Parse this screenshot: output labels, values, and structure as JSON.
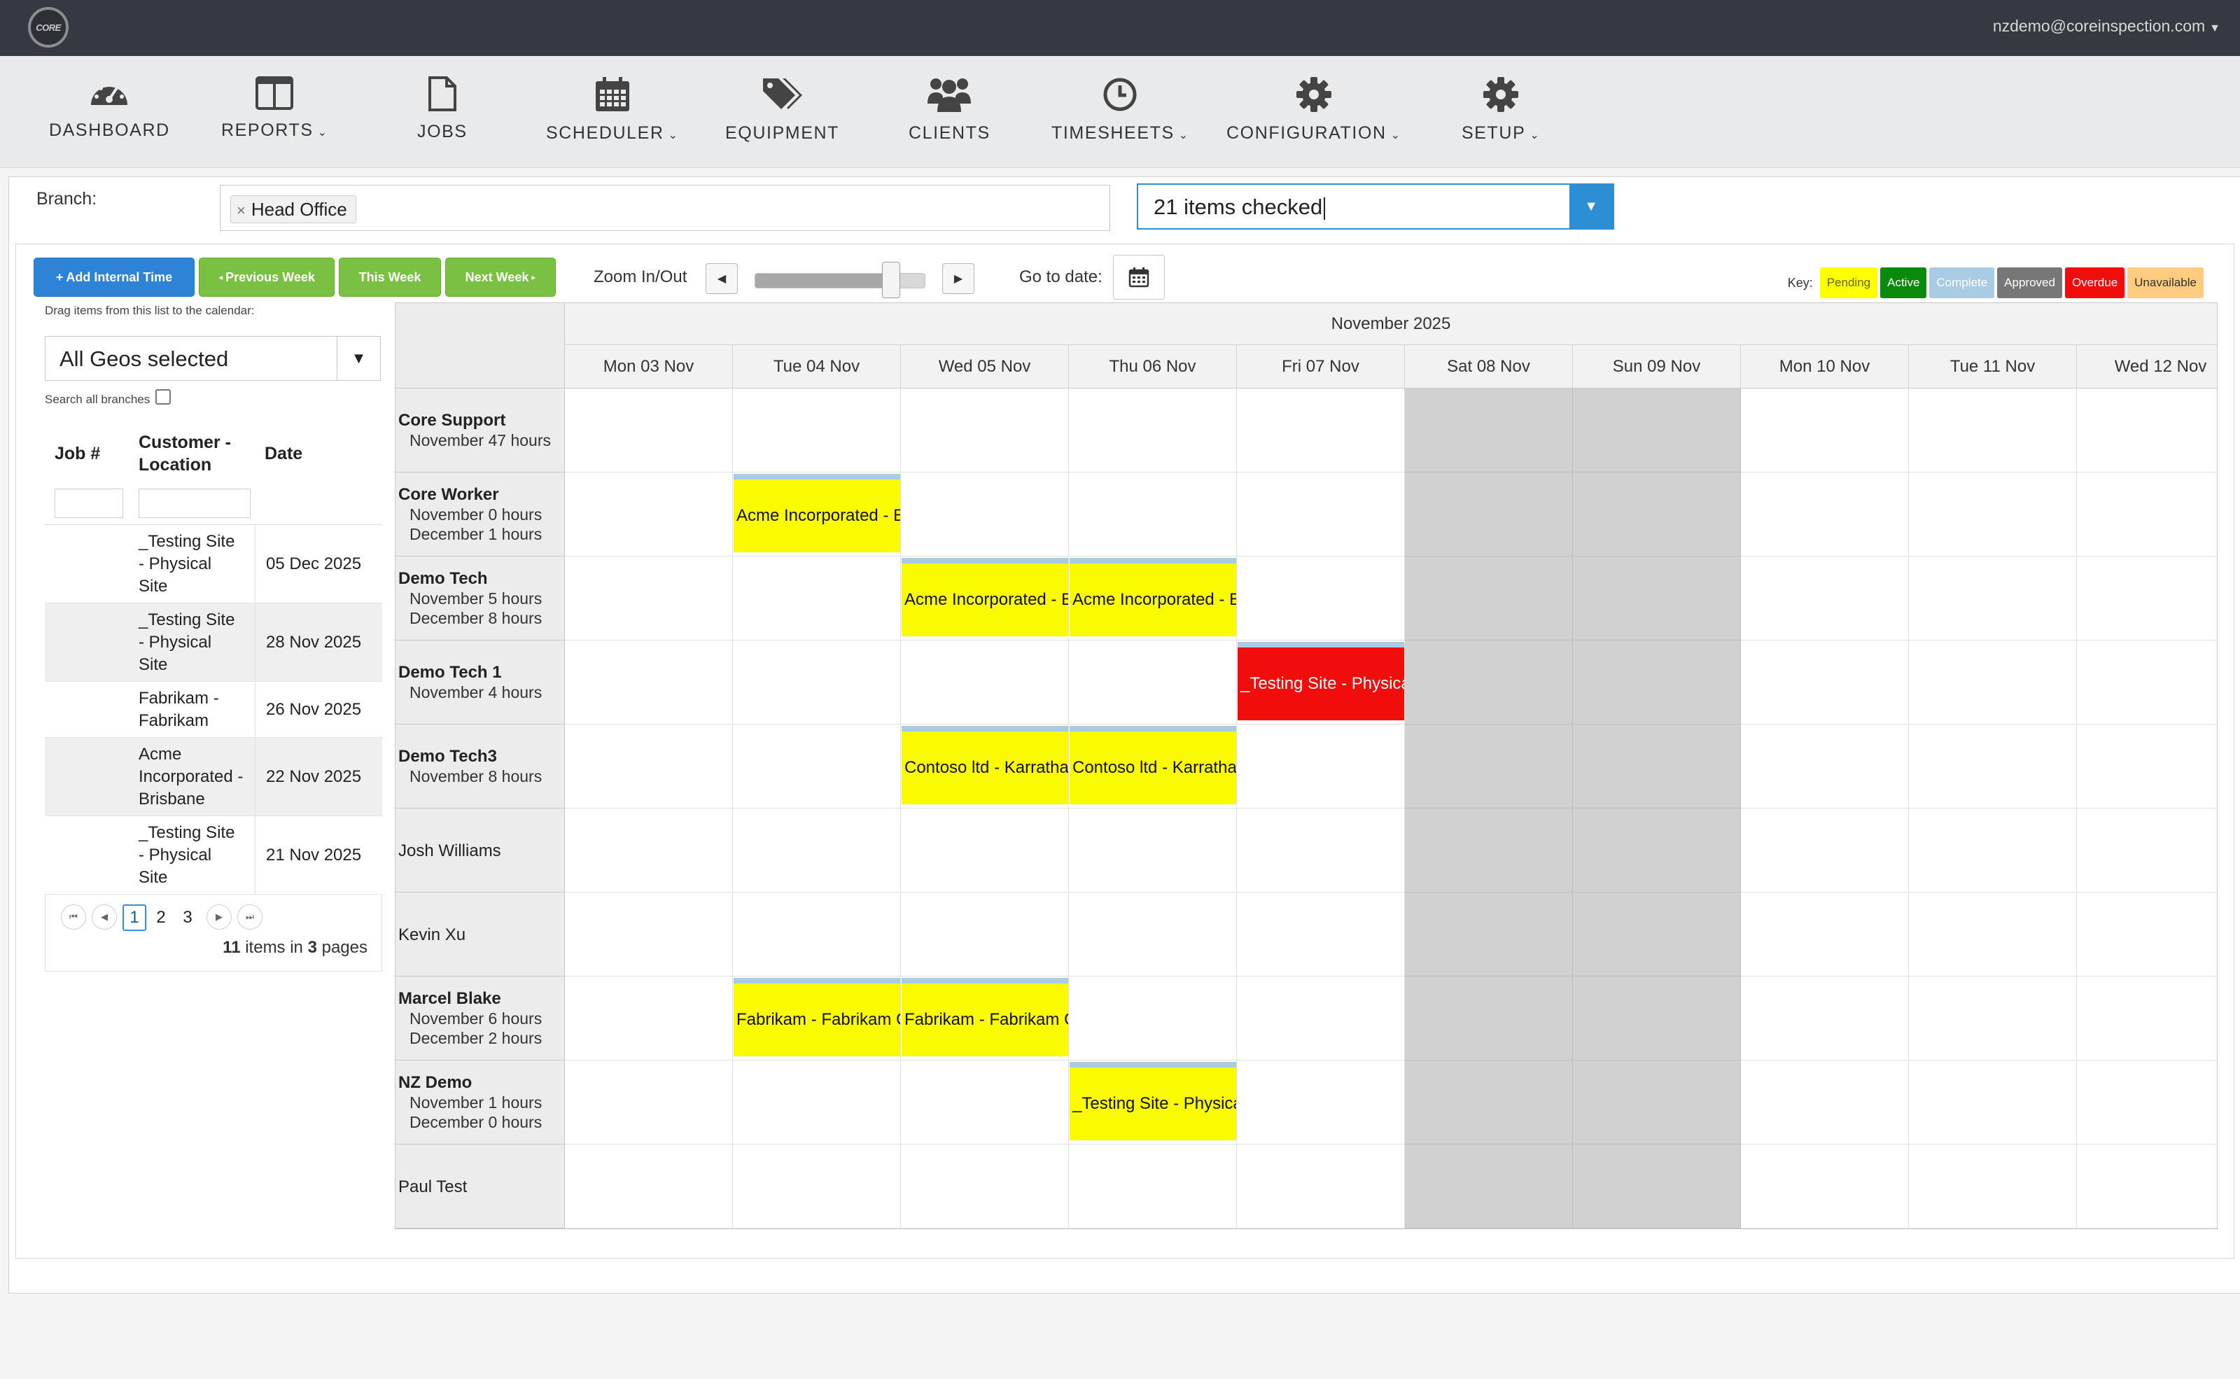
{
  "header": {
    "logo_text": "CORE",
    "user_email": "nzdemo@coreinspection.com"
  },
  "nav": [
    {
      "label": "DASHBOARD",
      "icon": "dashboard-gauge-icon",
      "dropdown": false
    },
    {
      "label": "REPORTS",
      "icon": "columns-icon",
      "dropdown": true
    },
    {
      "label": "JOBS",
      "icon": "file-icon",
      "dropdown": false
    },
    {
      "label": "SCHEDULER",
      "icon": "calendar-icon",
      "dropdown": true
    },
    {
      "label": "EQUIPMENT",
      "icon": "tags-icon",
      "dropdown": false
    },
    {
      "label": "CLIENTS",
      "icon": "users-icon",
      "dropdown": false
    },
    {
      "label": "TIMESHEETS",
      "icon": "clock-icon",
      "dropdown": true
    },
    {
      "label": "CONFIGURATION",
      "icon": "gear-icon",
      "dropdown": true
    },
    {
      "label": "SETUP",
      "icon": "gear-icon",
      "dropdown": true
    }
  ],
  "filters": {
    "branch_label": "Branch:",
    "branch_chip": "Head Office",
    "items_checked": "21 items checked"
  },
  "toolbar": {
    "add_internal_time": "Add Internal Time",
    "previous_week": "Previous Week",
    "this_week": "This Week",
    "next_week": "Next Week",
    "zoom_label": "Zoom In/Out",
    "zoom_level": 0.8,
    "goto_label": "Go to date:"
  },
  "key": {
    "label": "Key:",
    "items": [
      {
        "label": "Pending",
        "bg": "#ffff00",
        "fg": "#666600"
      },
      {
        "label": "Active",
        "bg": "#0a8a0a",
        "fg": "#ffffff"
      },
      {
        "label": "Complete",
        "bg": "#a9cbe3",
        "fg": "#ffffff"
      },
      {
        "label": "Approved",
        "bg": "#777777",
        "fg": "#ffffff"
      },
      {
        "label": "Overdue",
        "bg": "#f20d0d",
        "fg": "#ffffff"
      },
      {
        "label": "Unavailable",
        "bg": "#ffcc80",
        "fg": "#333333"
      }
    ]
  },
  "joblist": {
    "drag_hint": "Drag items from this list to the calendar:",
    "geo_select": "All Geos selected",
    "search_all_label": "Search all branches",
    "search_all_checked": false,
    "columns": {
      "job": "Job #",
      "customer_line1": "Customer -",
      "customer_line2": "Location",
      "date": "Date"
    },
    "rows": [
      {
        "lines": [
          "_Testing Site",
          "- Physical",
          "Site"
        ],
        "date": "05 Dec 2025"
      },
      {
        "lines": [
          "_Testing Site",
          "- Physical",
          "Site"
        ],
        "date": "28 Nov 2025"
      },
      {
        "lines": [
          "Fabrikam -",
          "Fabrikam"
        ],
        "date": "26 Nov 2025"
      },
      {
        "lines": [
          "Acme",
          "Incorporated -",
          "Brisbane"
        ],
        "date": "22 Nov 2025"
      },
      {
        "lines": [
          "_Testing Site",
          "- Physical",
          "Site"
        ],
        "date": "21 Nov 2025"
      }
    ],
    "pager": {
      "pages": [
        "1",
        "2",
        "3"
      ],
      "current": "1",
      "items_count": "11",
      "items_text": "items in",
      "pages_count": "3",
      "pages_text": "pages"
    }
  },
  "scheduler": {
    "month": "November 2025",
    "days": [
      {
        "label": "Mon 03 Nov",
        "weekend": false
      },
      {
        "label": "Tue 04 Nov",
        "weekend": false
      },
      {
        "label": "Wed 05 Nov",
        "weekend": false
      },
      {
        "label": "Thu 06 Nov",
        "weekend": false
      },
      {
        "label": "Fri 07 Nov",
        "weekend": false
      },
      {
        "label": "Sat 08 Nov",
        "weekend": true
      },
      {
        "label": "Sun 09 Nov",
        "weekend": true
      },
      {
        "label": "Mon 10 Nov",
        "weekend": false
      },
      {
        "label": "Tue 11 Nov",
        "weekend": false
      },
      {
        "label": "Wed 12 Nov",
        "weekend": false
      }
    ],
    "resources": [
      {
        "name": "Core Support",
        "bold": true,
        "hours": [
          "November 47 hours"
        ]
      },
      {
        "name": "Core Worker",
        "bold": true,
        "hours": [
          "November 0 hours",
          "December 1 hours"
        ]
      },
      {
        "name": "Demo Tech",
        "bold": true,
        "hours": [
          "November 5 hours",
          "December 8 hours"
        ]
      },
      {
        "name": "Demo Tech 1",
        "bold": true,
        "hours": [
          "November 4 hours"
        ]
      },
      {
        "name": "Demo Tech3",
        "bold": true,
        "hours": [
          "November 8 hours"
        ]
      },
      {
        "name": "Josh Williams",
        "bold": false,
        "hours": []
      },
      {
        "name": "Kevin Xu",
        "bold": false,
        "hours": []
      },
      {
        "name": "Marcel Blake",
        "bold": true,
        "hours": [
          "November 6 hours",
          "December 2 hours"
        ]
      },
      {
        "name": "NZ Demo",
        "bold": true,
        "hours": [
          "November 1 hours",
          "December 0 hours"
        ]
      },
      {
        "name": "Paul Test",
        "bold": false,
        "hours": []
      }
    ],
    "events": [
      {
        "resource": 1,
        "day": 1,
        "text": "Acme Incorporated - B",
        "status": "pending"
      },
      {
        "resource": 2,
        "day": 2,
        "text": "Acme Incorporated - B",
        "status": "pending"
      },
      {
        "resource": 2,
        "day": 3,
        "text": "Acme Incorporated - B",
        "status": "pending"
      },
      {
        "resource": 3,
        "day": 4,
        "text": "_Testing Site - Physica",
        "status": "overdue"
      },
      {
        "resource": 4,
        "day": 2,
        "text": "Contoso ltd - Karratha",
        "status": "pending"
      },
      {
        "resource": 4,
        "day": 3,
        "text": "Contoso ltd - Karratha",
        "status": "pending"
      },
      {
        "resource": 7,
        "day": 1,
        "text": "Fabrikam - Fabrikam C",
        "status": "pending"
      },
      {
        "resource": 7,
        "day": 2,
        "text": "Fabrikam - Fabrikam C",
        "status": "pending"
      },
      {
        "resource": 8,
        "day": 3,
        "text": "_Testing Site - Physica",
        "status": "pending"
      }
    ]
  }
}
